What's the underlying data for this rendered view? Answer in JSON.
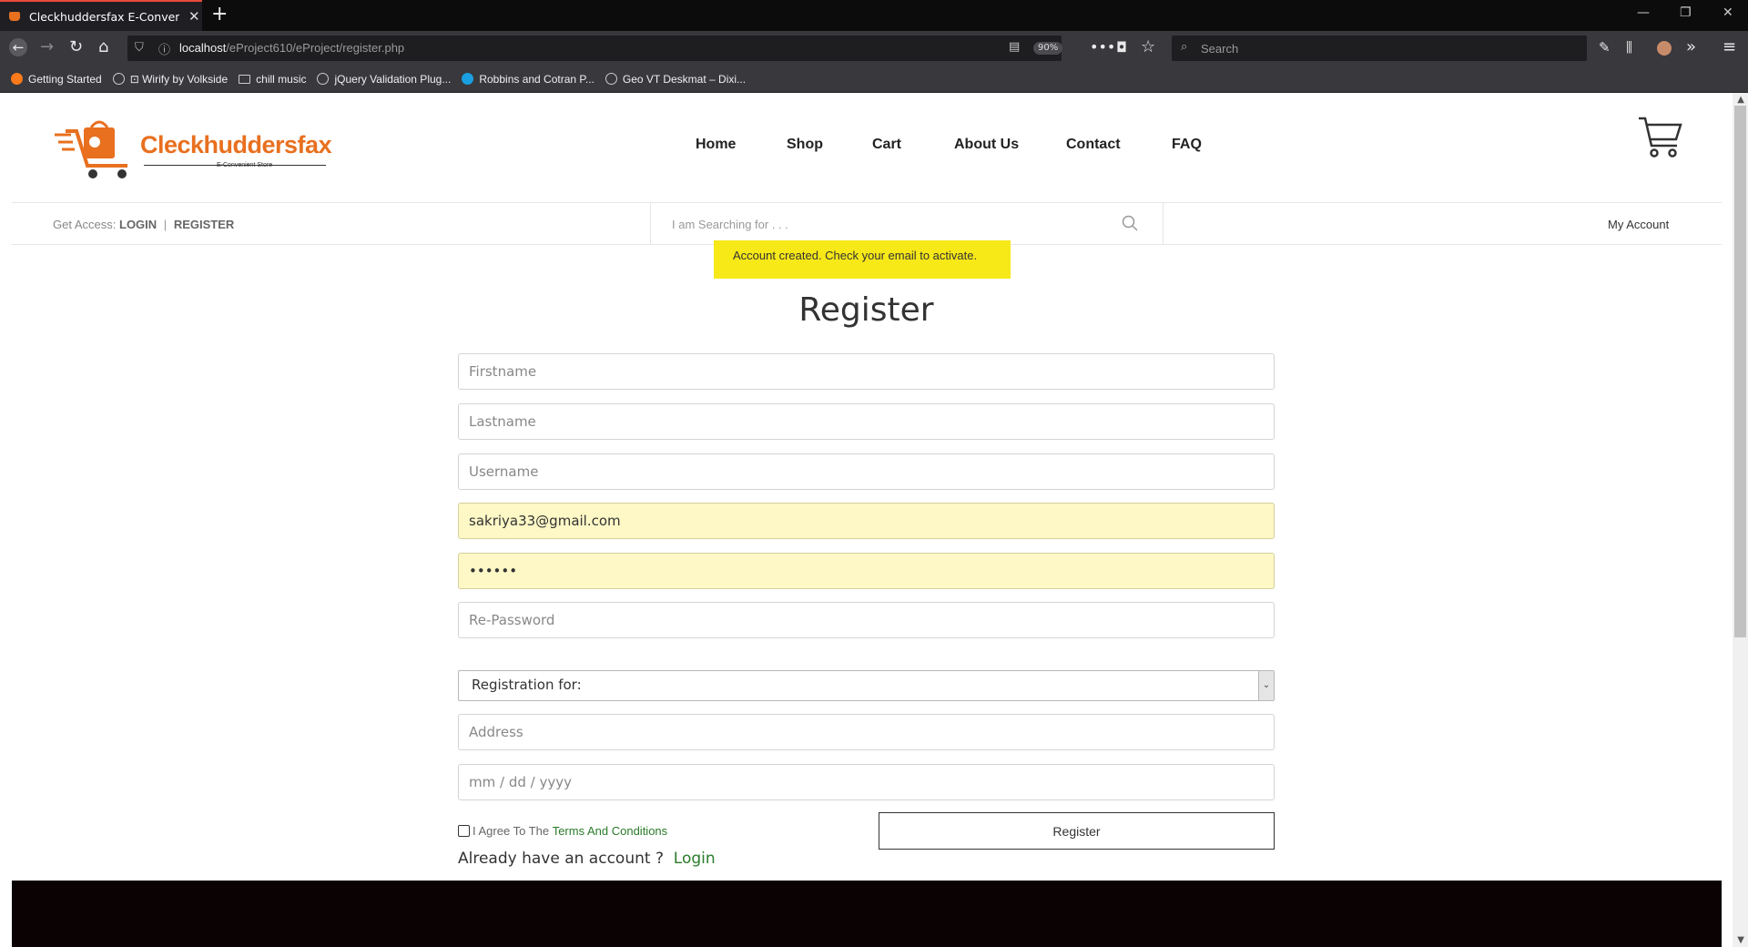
{
  "browser": {
    "tab_title": "Cleckhuddersfax E-Convenient Store",
    "tab_close": "✕",
    "new_tab": "+",
    "url_host": "localhost",
    "url_path": "/eProject610/eProject/register.php",
    "zoom": "90%",
    "search_placeholder": "Search",
    "bookmarks": [
      {
        "label": "Getting Started",
        "icon": "firefox-icon"
      },
      {
        "label": "⊡ Wirify by Volkside",
        "icon": "globe-icon"
      },
      {
        "label": "chill music",
        "icon": "folder-icon"
      },
      {
        "label": "jQuery Validation Plug...",
        "icon": "globe-icon"
      },
      {
        "label": "Robbins and Cotran P...",
        "icon": "blue-globe-icon"
      },
      {
        "label": "Geo VT Deskmat – Dixi...",
        "icon": "globe-icon"
      }
    ]
  },
  "site": {
    "logo_name": "Cleckhuddersfax",
    "logo_tagline": "E-Convenient Store",
    "nav": [
      "Home",
      "Shop",
      "Cart",
      "About Us",
      "Contact",
      "FAQ"
    ],
    "access_label": "Get Access:",
    "login_link": "LOGIN",
    "access_sep": "|",
    "register_link": "REGISTER",
    "search_placeholder": "I am Searching for . . .",
    "my_account": "My Account",
    "alert": "Account created. Check your email to activate.",
    "brand_color": "#e8701f",
    "alert_color": "#f7e818"
  },
  "form": {
    "title": "Register",
    "firstname_placeholder": "Firstname",
    "lastname_placeholder": "Lastname",
    "username_placeholder": "Username",
    "email_value": "sakriya33@gmail.com",
    "password_value": "••••••",
    "repassword_placeholder": "Re-Password",
    "registration_for": "Registration for:",
    "address_placeholder": "Address",
    "date_placeholder": "mm / dd / yyyy",
    "agree_text": "I Agree To The ",
    "terms_link": "Terms And Conditions",
    "register_button": "Register",
    "have_account_text": "Already have an account ? ",
    "login_link": "Login"
  }
}
